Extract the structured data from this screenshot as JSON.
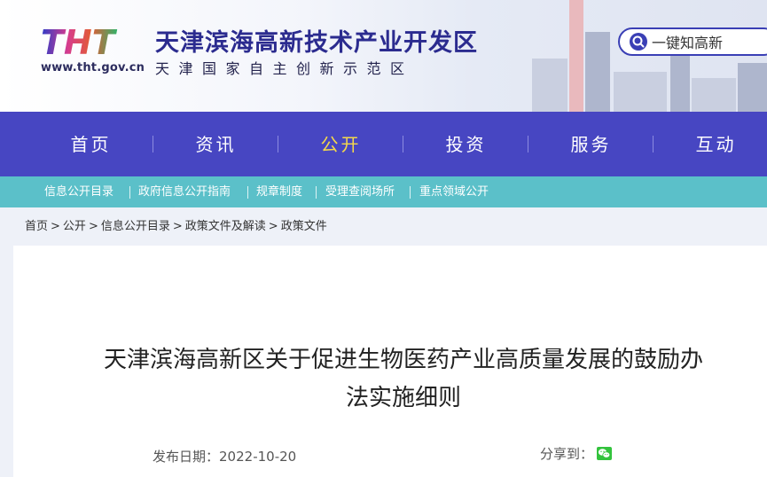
{
  "header": {
    "logo_text": "THT",
    "site_url": "www.tht.gov.cn",
    "title": "天津滨海高新技术产业开发区",
    "subtitle": "天津国家自主创新示范区",
    "search_label": "一键知高新"
  },
  "nav": {
    "items": [
      {
        "label": "首页"
      },
      {
        "label": "资讯"
      },
      {
        "label": "公开"
      },
      {
        "label": "投资"
      },
      {
        "label": "服务"
      },
      {
        "label": "互动"
      }
    ],
    "active": "公开"
  },
  "subnav": {
    "items": [
      {
        "label": "信息公开目录"
      },
      {
        "label": "政府信息公开指南"
      },
      {
        "label": "规章制度"
      },
      {
        "label": "受理查阅场所"
      },
      {
        "label": "重点领域公开"
      }
    ]
  },
  "breadcrumb": {
    "items": [
      "首页",
      "公开",
      "信息公开目录",
      "政策文件及解读",
      "政策文件"
    ],
    "separator": ">"
  },
  "article": {
    "title_line1": "天津滨海高新区关于促进生物医药产业高质量发展的鼓励办",
    "title_line2": "法实施细则",
    "date_label": "发布日期：",
    "date": "2022-10-20",
    "share_label": "分享到："
  },
  "colors": {
    "nav_bg": "#4746c2",
    "nav_active": "#f5d94a",
    "subnav_bg": "#5bc0c9",
    "title_blue": "#2b2b8f",
    "wechat_green": "#33c33d"
  },
  "icons": {
    "search": "magnifier-icon",
    "share": "wechat-icon"
  }
}
